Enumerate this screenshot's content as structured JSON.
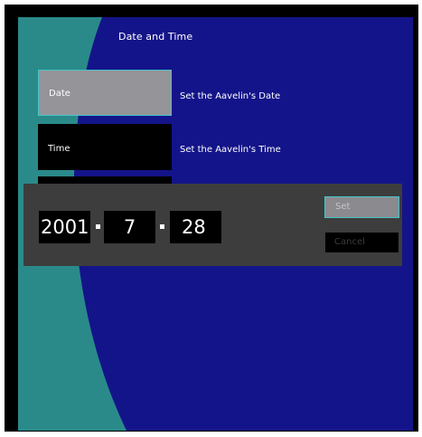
{
  "screen": {
    "title": "Date and Time"
  },
  "menu": {
    "items": [
      {
        "label": "Date",
        "description": "Set the Aavelin's Date",
        "selected": true
      },
      {
        "label": "Time",
        "description": "Set the Aavelin's Time",
        "selected": false
      }
    ]
  },
  "date_dialog": {
    "year": "2001",
    "month": "7",
    "day": "28",
    "set_label": "Set",
    "cancel_label": "Cancel"
  },
  "colors": {
    "screen_blue": "#14148a",
    "accent_teal": "#2a8a8a",
    "selected_border": "#46c6c8",
    "panel_gray": "#3d3d3d"
  }
}
